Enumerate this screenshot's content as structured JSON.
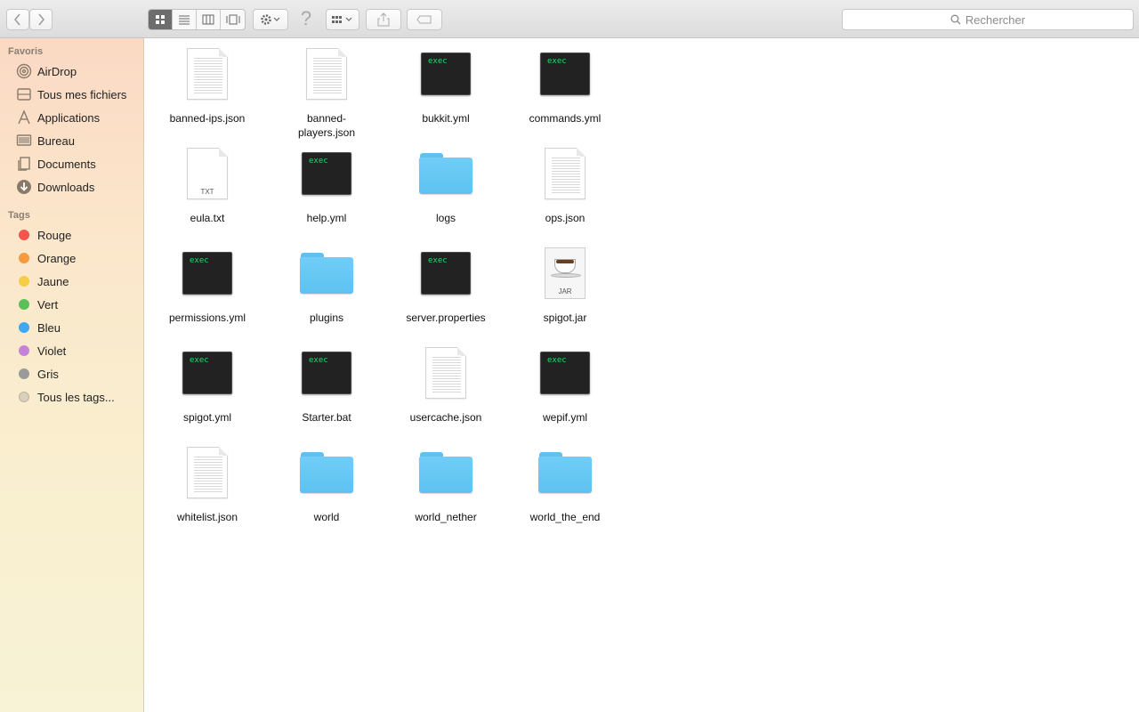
{
  "toolbar": {
    "search_placeholder": "Rechercher",
    "help_glyph": "?"
  },
  "sidebar": {
    "favorites_header": "Favoris",
    "favorites": [
      {
        "label": "AirDrop",
        "icon": "airdrop-icon"
      },
      {
        "label": "Tous mes fichiers",
        "icon": "all-files-icon"
      },
      {
        "label": "Applications",
        "icon": "applications-icon"
      },
      {
        "label": "Bureau",
        "icon": "desktop-icon"
      },
      {
        "label": "Documents",
        "icon": "documents-icon"
      },
      {
        "label": "Downloads",
        "icon": "downloads-icon"
      }
    ],
    "tags_header": "Tags",
    "tags": [
      {
        "label": "Rouge",
        "color": "#f4554e"
      },
      {
        "label": "Orange",
        "color": "#f59a3f"
      },
      {
        "label": "Jaune",
        "color": "#f5cd47"
      },
      {
        "label": "Vert",
        "color": "#5ac05a"
      },
      {
        "label": "Bleu",
        "color": "#3fa8f0"
      },
      {
        "label": "Violet",
        "color": "#c583d8"
      },
      {
        "label": "Gris",
        "color": "#9a9a9a"
      },
      {
        "label": "Tous les tags...",
        "color": "#d8d0bc"
      }
    ]
  },
  "files": [
    {
      "name": "banned-ips.json",
      "kind": "doc"
    },
    {
      "name": "banned-players.json",
      "kind": "doc"
    },
    {
      "name": "bukkit.yml",
      "kind": "exec"
    },
    {
      "name": "commands.yml",
      "kind": "exec"
    },
    {
      "name": "eula.txt",
      "kind": "txt"
    },
    {
      "name": "help.yml",
      "kind": "exec"
    },
    {
      "name": "logs",
      "kind": "folder"
    },
    {
      "name": "ops.json",
      "kind": "doc"
    },
    {
      "name": "permissions.yml",
      "kind": "exec"
    },
    {
      "name": "plugins",
      "kind": "folder"
    },
    {
      "name": "server.properties",
      "kind": "exec"
    },
    {
      "name": "spigot.jar",
      "kind": "jar"
    },
    {
      "name": "spigot.yml",
      "kind": "exec"
    },
    {
      "name": "Starter.bat",
      "kind": "exec"
    },
    {
      "name": "usercache.json",
      "kind": "doc"
    },
    {
      "name": "wepif.yml",
      "kind": "exec"
    },
    {
      "name": "whitelist.json",
      "kind": "doc"
    },
    {
      "name": "world",
      "kind": "folder"
    },
    {
      "name": "world_nether",
      "kind": "folder"
    },
    {
      "name": "world_the_end",
      "kind": "folder"
    }
  ],
  "icon_text": {
    "exec": "exec",
    "txt": "TXT",
    "jar": "JAR"
  }
}
